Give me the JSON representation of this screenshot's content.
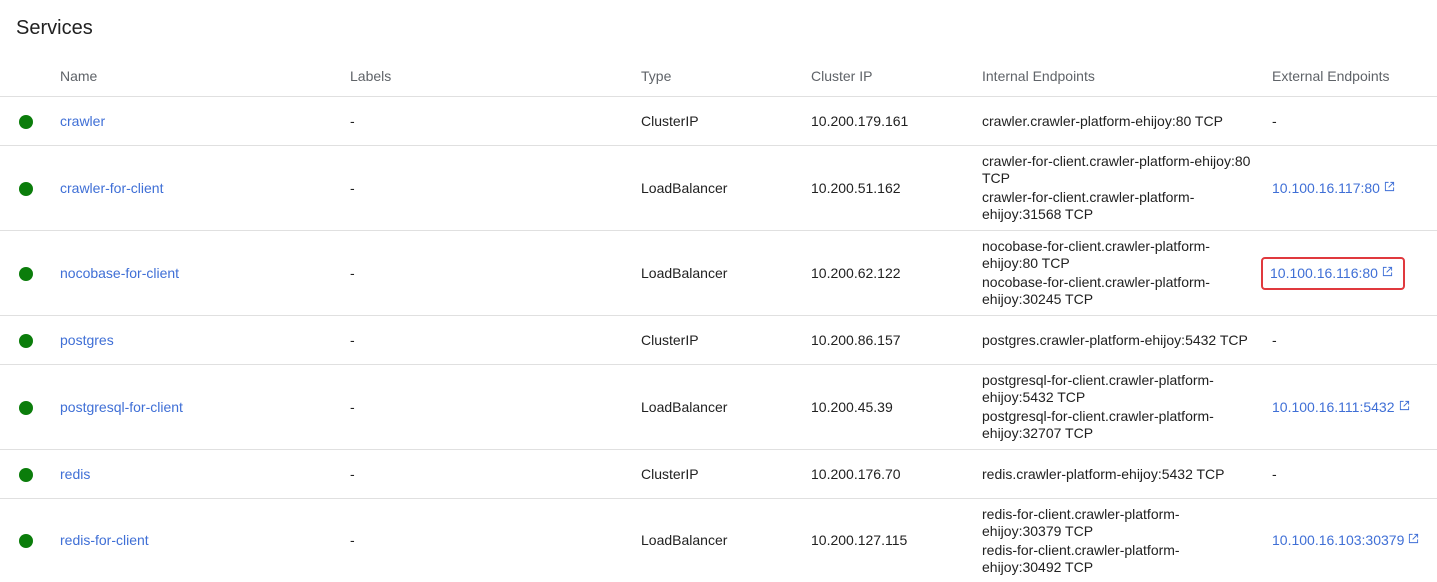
{
  "page": {
    "title": "Services"
  },
  "table": {
    "headers": {
      "name": "Name",
      "labels": "Labels",
      "type": "Type",
      "cluster_ip": "Cluster IP",
      "internal": "Internal Endpoints",
      "external": "External Endpoints"
    },
    "status_color": "#0b7d0b",
    "link_color": "#3f6fd6",
    "highlight_color": "#e0393e",
    "rows": [
      {
        "name": "crawler",
        "labels": "-",
        "type": "ClusterIP",
        "cluster_ip": "10.200.179.161",
        "internal": [
          "crawler.crawler-platform-ehijoy:80 TCP"
        ],
        "external": "-"
      },
      {
        "name": "crawler-for-client",
        "labels": "-",
        "type": "LoadBalancer",
        "cluster_ip": "10.200.51.162",
        "internal": [
          "crawler-for-client.crawler-platform-ehijoy:80 TCP",
          "crawler-for-client.crawler-platform-ehijoy:31568 TCP"
        ],
        "external": "10.100.16.117:80"
      },
      {
        "name": "nocobase-for-client",
        "labels": "-",
        "type": "LoadBalancer",
        "cluster_ip": "10.200.62.122",
        "internal": [
          "nocobase-for-client.crawler-platform-ehijoy:80 TCP",
          "nocobase-for-client.crawler-platform-ehijoy:30245 TCP"
        ],
        "external": "10.100.16.116:80"
      },
      {
        "name": "postgres",
        "labels": "-",
        "type": "ClusterIP",
        "cluster_ip": "10.200.86.157",
        "internal": [
          "postgres.crawler-platform-ehijoy:5432 TCP"
        ],
        "external": "-"
      },
      {
        "name": "postgresql-for-client",
        "labels": "-",
        "type": "LoadBalancer",
        "cluster_ip": "10.200.45.39",
        "internal": [
          "postgresql-for-client.crawler-platform-ehijoy:5432 TCP",
          "postgresql-for-client.crawler-platform-ehijoy:32707 TCP"
        ],
        "external": "10.100.16.111:5432"
      },
      {
        "name": "redis",
        "labels": "-",
        "type": "ClusterIP",
        "cluster_ip": "10.200.176.70",
        "internal": [
          "redis.crawler-platform-ehijoy:5432 TCP"
        ],
        "external": "-"
      },
      {
        "name": "redis-for-client",
        "labels": "-",
        "type": "LoadBalancer",
        "cluster_ip": "10.200.127.115",
        "internal": [
          "redis-for-client.crawler-platform-ehijoy:30379 TCP",
          "redis-for-client.crawler-platform-ehijoy:30492 TCP"
        ],
        "external": "10.100.16.103:30379"
      }
    ]
  }
}
